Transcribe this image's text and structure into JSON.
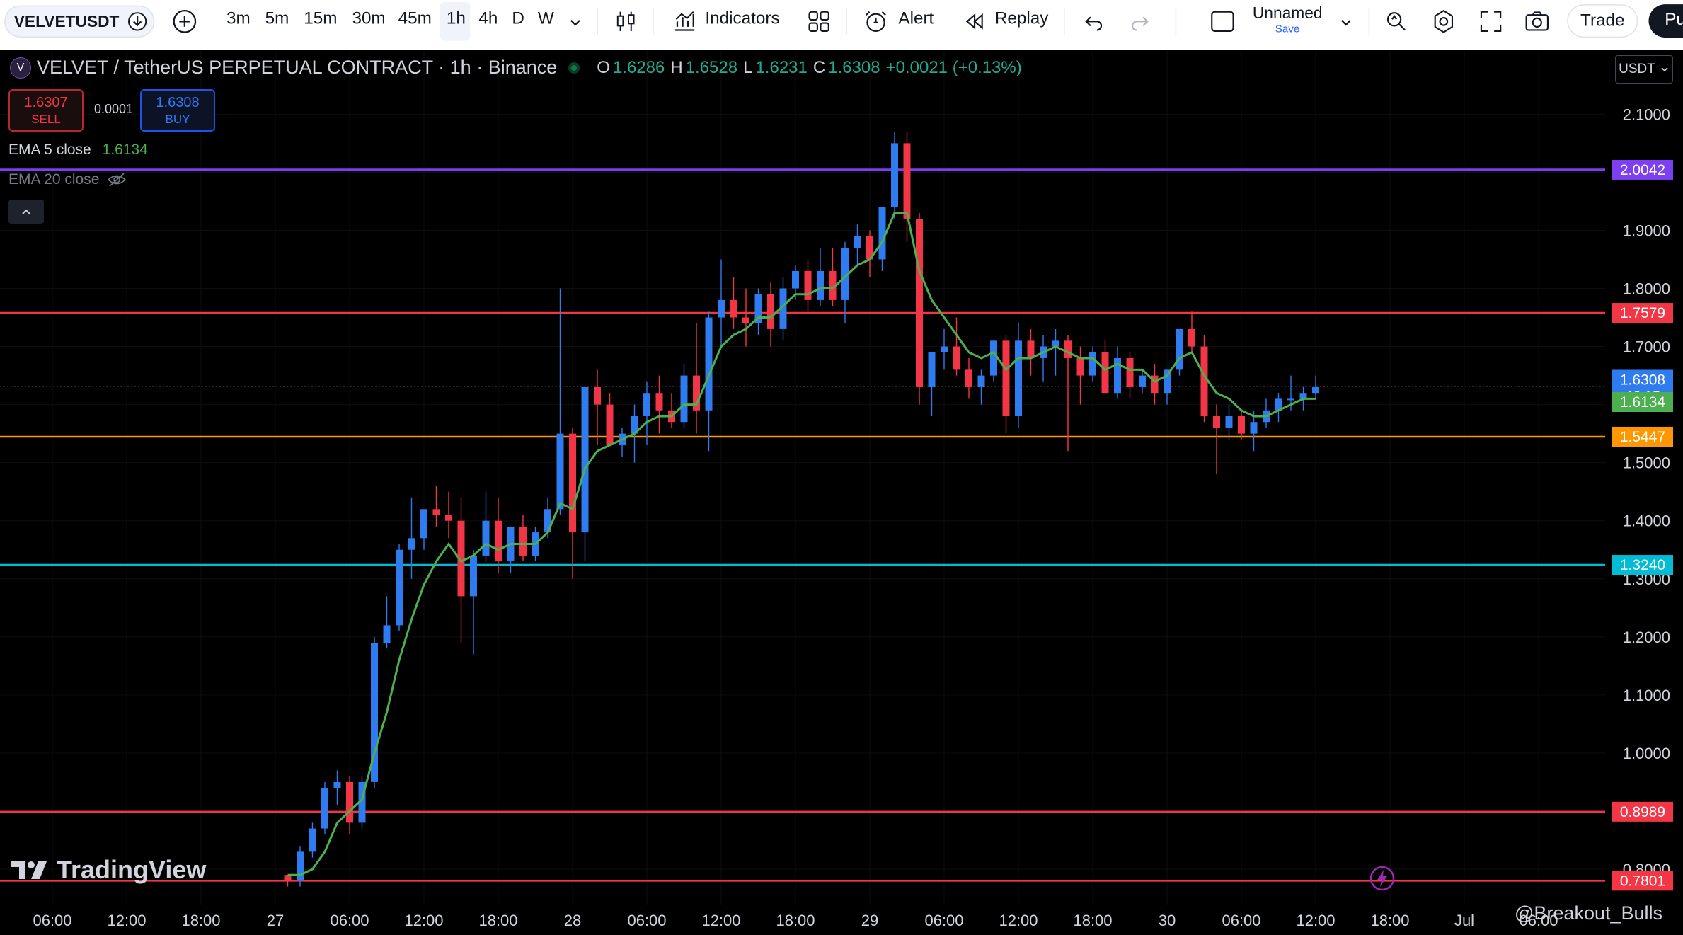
{
  "toolbar": {
    "symbol": "VELVETUSDT",
    "timeframes": [
      "3m",
      "5m",
      "15m",
      "30m",
      "45m",
      "1h",
      "4h",
      "D",
      "W"
    ],
    "active_timeframe": "1h",
    "indicators_label": "Indicators",
    "alert_label": "Alert",
    "replay_label": "Replay",
    "layout_name": "Unnamed",
    "save_label": "Save",
    "trade_label": "Trade",
    "publish_label": "Pu"
  },
  "legend": {
    "logo_letter": "V",
    "title": "VELVET / TetherUS PERPETUAL CONTRACT · 1h · Binance",
    "o_label": "O",
    "o": "1.6286",
    "h_label": "H",
    "h": "1.6528",
    "l_label": "L",
    "l": "1.6231",
    "c_label": "C",
    "c": "1.6308",
    "change": "+0.0021 (+0.13%)"
  },
  "trade": {
    "sell_price": "1.6307",
    "sell_label": "SELL",
    "spread": "0.0001",
    "buy_price": "1.6308",
    "buy_label": "BUY"
  },
  "indicators": {
    "ema5_label": "EMA 5 close",
    "ema5_value": "1.6134",
    "ema20_label": "EMA 20 close"
  },
  "currency_button": "USDT",
  "watermark": "TradingView",
  "credit": "@Breakout_Bulls",
  "colors": {
    "background": "#000000",
    "up": "#2f7bf0",
    "down": "#f23645",
    "ema5": "#4caf50",
    "purple_line": "#7e3ff2",
    "red_line": "#f23645",
    "orange_line": "#ff9800",
    "cyan_line": "#00bcd4"
  },
  "chart_data": {
    "type": "candlestick",
    "interval": "1h",
    "price_axis": {
      "ticks": [
        0.8,
        0.9,
        1.0,
        1.1,
        1.2,
        1.3,
        1.4,
        1.5,
        1.6,
        1.7,
        1.8,
        1.9,
        2.0,
        2.1
      ],
      "tick_labels": [
        "0.8000",
        "0.9000",
        "1.0000",
        "1.1000",
        "1.2000",
        "1.3000",
        "1.4000",
        "1.5000",
        "1.6000",
        "1.7000",
        "1.8000",
        "1.9000",
        "2.0000",
        "2.1000"
      ],
      "range": [
        0.77,
        2.155
      ]
    },
    "time_axis": {
      "labels": [
        "06:00",
        "12:00",
        "18:00",
        "27",
        "06:00",
        "12:00",
        "18:00",
        "28",
        "06:00",
        "12:00",
        "18:00",
        "29",
        "06:00",
        "12:00",
        "18:00",
        "30",
        "06:00",
        "12:00",
        "18:00",
        "Jul",
        "06:00"
      ],
      "hours_from_start": [
        6,
        12,
        18,
        24,
        30,
        36,
        42,
        48,
        54,
        60,
        66,
        72,
        78,
        84,
        90,
        96,
        102,
        108,
        114,
        120,
        126
      ]
    },
    "horizontal_levels": [
      {
        "price": 2.0042,
        "label": "2.0042",
        "color": "#7e3ff2",
        "width": 3
      },
      {
        "price": 1.7579,
        "label": "1.7579",
        "color": "#f23645",
        "width": 2
      },
      {
        "price": 1.5447,
        "label": "1.5447",
        "color": "#ff9800",
        "width": 2
      },
      {
        "price": 1.324,
        "label": "1.3240",
        "color": "#00bcd4",
        "width": 2
      },
      {
        "price": 0.8989,
        "label": "0.8989",
        "color": "#f23645",
        "width": 2
      },
      {
        "price": 0.7801,
        "label": "0.7801",
        "color": "#f23645",
        "width": 2
      }
    ],
    "price_tags": [
      {
        "label": "1.6308",
        "sub": "46:15",
        "price": 1.6308,
        "color": "#2f7bf0"
      },
      {
        "label": "1.6134",
        "price": 1.6134,
        "color": "#4caf50"
      }
    ],
    "candles_start_hour": 25,
    "candles": [
      [
        0.79,
        0.79,
        0.77,
        0.78
      ],
      [
        0.78,
        0.84,
        0.77,
        0.83
      ],
      [
        0.83,
        0.88,
        0.82,
        0.87
      ],
      [
        0.87,
        0.95,
        0.86,
        0.94
      ],
      [
        0.94,
        0.97,
        0.91,
        0.95
      ],
      [
        0.95,
        0.96,
        0.86,
        0.88
      ],
      [
        0.88,
        0.96,
        0.87,
        0.95
      ],
      [
        0.95,
        1.2,
        0.94,
        1.19
      ],
      [
        1.19,
        1.27,
        1.18,
        1.22
      ],
      [
        1.22,
        1.36,
        1.21,
        1.35
      ],
      [
        1.35,
        1.44,
        1.3,
        1.37
      ],
      [
        1.37,
        1.42,
        1.35,
        1.42
      ],
      [
        1.42,
        1.46,
        1.39,
        1.41
      ],
      [
        1.41,
        1.45,
        1.37,
        1.4
      ],
      [
        1.4,
        1.44,
        1.19,
        1.27
      ],
      [
        1.27,
        1.35,
        1.17,
        1.34
      ],
      [
        1.34,
        1.45,
        1.33,
        1.4
      ],
      [
        1.4,
        1.44,
        1.31,
        1.33
      ],
      [
        1.33,
        1.39,
        1.31,
        1.39
      ],
      [
        1.39,
        1.41,
        1.33,
        1.34
      ],
      [
        1.34,
        1.39,
        1.33,
        1.38
      ],
      [
        1.38,
        1.44,
        1.37,
        1.42
      ],
      [
        1.42,
        1.8,
        1.41,
        1.55
      ],
      [
        1.55,
        1.56,
        1.3,
        1.38
      ],
      [
        1.38,
        1.63,
        1.33,
        1.63
      ],
      [
        1.63,
        1.66,
        1.53,
        1.6
      ],
      [
        1.6,
        1.62,
        1.53,
        1.53
      ],
      [
        1.53,
        1.56,
        1.51,
        1.55
      ],
      [
        1.55,
        1.6,
        1.5,
        1.58
      ],
      [
        1.58,
        1.64,
        1.53,
        1.62
      ],
      [
        1.62,
        1.65,
        1.55,
        1.59
      ],
      [
        1.59,
        1.62,
        1.56,
        1.57
      ],
      [
        1.57,
        1.67,
        1.56,
        1.65
      ],
      [
        1.65,
        1.74,
        1.55,
        1.59
      ],
      [
        1.59,
        1.76,
        1.52,
        1.75
      ],
      [
        1.75,
        1.85,
        1.7,
        1.78
      ],
      [
        1.78,
        1.82,
        1.73,
        1.75
      ],
      [
        1.75,
        1.8,
        1.7,
        1.74
      ],
      [
        1.74,
        1.8,
        1.72,
        1.79
      ],
      [
        1.79,
        1.81,
        1.7,
        1.73
      ],
      [
        1.73,
        1.82,
        1.71,
        1.8
      ],
      [
        1.8,
        1.84,
        1.78,
        1.83
      ],
      [
        1.83,
        1.85,
        1.76,
        1.78
      ],
      [
        1.78,
        1.87,
        1.77,
        1.83
      ],
      [
        1.83,
        1.87,
        1.77,
        1.78
      ],
      [
        1.78,
        1.88,
        1.74,
        1.87
      ],
      [
        1.87,
        1.91,
        1.84,
        1.89
      ],
      [
        1.89,
        1.9,
        1.82,
        1.85
      ],
      [
        1.85,
        1.94,
        1.83,
        1.94
      ],
      [
        1.94,
        2.07,
        1.92,
        2.05
      ],
      [
        2.05,
        2.07,
        1.88,
        1.92
      ],
      [
        1.92,
        1.93,
        1.6,
        1.63
      ],
      [
        1.63,
        1.69,
        1.58,
        1.69
      ],
      [
        1.69,
        1.73,
        1.66,
        1.7
      ],
      [
        1.7,
        1.75,
        1.65,
        1.66
      ],
      [
        1.66,
        1.68,
        1.61,
        1.63
      ],
      [
        1.63,
        1.66,
        1.6,
        1.65
      ],
      [
        1.65,
        1.71,
        1.64,
        1.71
      ],
      [
        1.71,
        1.72,
        1.55,
        1.58
      ],
      [
        1.58,
        1.74,
        1.56,
        1.71
      ],
      [
        1.71,
        1.73,
        1.65,
        1.68
      ],
      [
        1.68,
        1.72,
        1.64,
        1.7
      ],
      [
        1.7,
        1.73,
        1.65,
        1.71
      ],
      [
        1.71,
        1.72,
        1.52,
        1.68
      ],
      [
        1.68,
        1.7,
        1.6,
        1.65
      ],
      [
        1.65,
        1.7,
        1.64,
        1.69
      ],
      [
        1.69,
        1.71,
        1.62,
        1.62
      ],
      [
        1.62,
        1.7,
        1.61,
        1.68
      ],
      [
        1.68,
        1.69,
        1.61,
        1.63
      ],
      [
        1.63,
        1.66,
        1.62,
        1.65
      ],
      [
        1.65,
        1.67,
        1.6,
        1.62
      ],
      [
        1.62,
        1.66,
        1.6,
        1.66
      ],
      [
        1.66,
        1.73,
        1.65,
        1.73
      ],
      [
        1.73,
        1.76,
        1.69,
        1.7
      ],
      [
        1.7,
        1.72,
        1.57,
        1.58
      ],
      [
        1.58,
        1.6,
        1.48,
        1.56
      ],
      [
        1.56,
        1.6,
        1.54,
        1.58
      ],
      [
        1.58,
        1.59,
        1.54,
        1.55
      ],
      [
        1.55,
        1.59,
        1.52,
        1.57
      ],
      [
        1.57,
        1.61,
        1.56,
        1.59
      ],
      [
        1.59,
        1.62,
        1.57,
        1.61
      ],
      [
        1.61,
        1.65,
        1.59,
        1.61
      ],
      [
        1.61,
        1.63,
        1.59,
        1.62
      ],
      [
        1.62,
        1.65,
        1.61,
        1.63
      ]
    ],
    "ema5": [
      0.79,
      0.79,
      0.8,
      0.83,
      0.88,
      0.9,
      0.92,
      1.0,
      1.07,
      1.16,
      1.23,
      1.29,
      1.33,
      1.36,
      1.33,
      1.34,
      1.36,
      1.35,
      1.36,
      1.36,
      1.36,
      1.38,
      1.43,
      1.42,
      1.49,
      1.52,
      1.53,
      1.54,
      1.55,
      1.57,
      1.58,
      1.58,
      1.6,
      1.6,
      1.65,
      1.7,
      1.72,
      1.73,
      1.75,
      1.75,
      1.77,
      1.79,
      1.79,
      1.8,
      1.8,
      1.82,
      1.84,
      1.85,
      1.88,
      1.93,
      1.93,
      1.83,
      1.78,
      1.75,
      1.72,
      1.69,
      1.68,
      1.69,
      1.66,
      1.68,
      1.68,
      1.69,
      1.7,
      1.69,
      1.68,
      1.68,
      1.66,
      1.67,
      1.66,
      1.66,
      1.64,
      1.65,
      1.68,
      1.69,
      1.65,
      1.62,
      1.61,
      1.59,
      1.58,
      1.58,
      1.59,
      1.6,
      1.61,
      1.61
    ]
  }
}
